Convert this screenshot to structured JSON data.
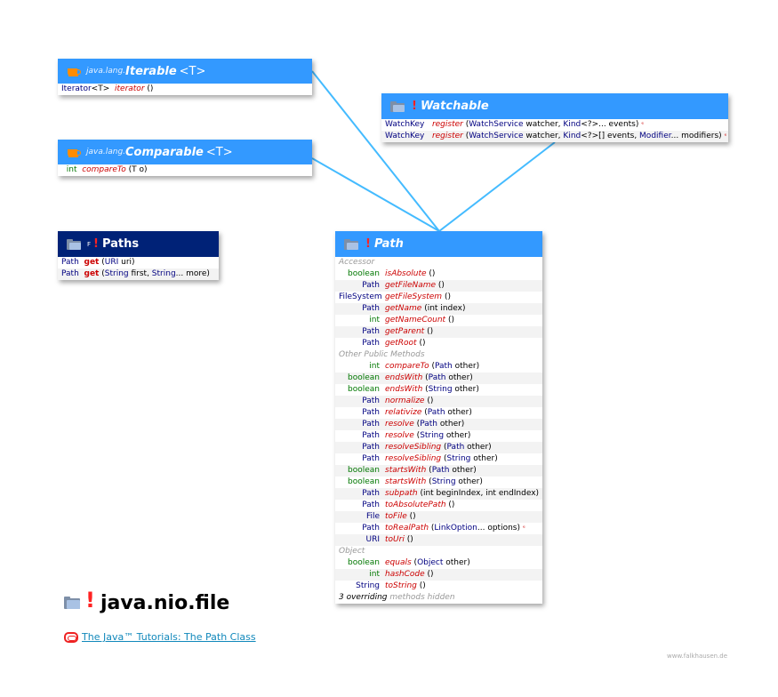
{
  "iterable": {
    "pkg": "java.lang.",
    "name": "Iterable",
    "type_param": "<T>",
    "methods": [
      {
        "ret": "Iterator",
        "ret_gen": "<T>",
        "name": "iterator",
        "params": "()"
      }
    ]
  },
  "comparable": {
    "pkg": "java.lang.",
    "name": "Comparable",
    "type_param": "<T>",
    "methods": [
      {
        "ret": "int",
        "name": "compareTo",
        "params": "(T o)"
      }
    ]
  },
  "watchable": {
    "excl": "!",
    "name": "Watchable",
    "methods": [
      {
        "ret": "WatchKey",
        "name": "register",
        "p1": "(",
        "p2": "WatchService",
        "p3": " watcher, ",
        "p4": "Kind",
        "p5": "<?>... events)",
        "ex": "ᵉ"
      },
      {
        "ret": "WatchKey",
        "name": "register",
        "p1": "(",
        "p2": "WatchService",
        "p3": " watcher, ",
        "p4": "Kind",
        "p5": "<?>[] events, ",
        "p6": "Modifier",
        "p7": "... modifiers)",
        "ex": "ᵉ"
      }
    ]
  },
  "paths": {
    "sup": "F",
    "excl": "!",
    "name": "Paths",
    "methods": [
      {
        "ret": "Path",
        "name": "get",
        "p1": "(",
        "p2": "URI",
        "p3": " uri)"
      },
      {
        "ret": "Path",
        "name": "get",
        "p1": "(",
        "p2": "String",
        "p3": " first, ",
        "p4": "String",
        "p5": "... more)"
      }
    ]
  },
  "path": {
    "excl": "!",
    "name": "Path",
    "sec_accessor": "Accessor",
    "sec_other": "Other Public Methods",
    "sec_object": "Object",
    "accessor": [
      {
        "ret": "boolean",
        "prim": true,
        "name": "isAbsolute",
        "params": "()"
      },
      {
        "ret": "Path",
        "name": "getFileName",
        "params": "()"
      },
      {
        "ret": "FileSystem",
        "name": "getFileSystem",
        "params": "()"
      },
      {
        "ret": "Path",
        "name": "getName",
        "params": "(int index)"
      },
      {
        "ret": "int",
        "prim": true,
        "name": "getNameCount",
        "params": "()"
      },
      {
        "ret": "Path",
        "name": "getParent",
        "params": "()"
      },
      {
        "ret": "Path",
        "name": "getRoot",
        "params": "()"
      }
    ],
    "other": [
      {
        "ret": "int",
        "prim": true,
        "name": "compareTo",
        "pt": "Path",
        "pr": " other)"
      },
      {
        "ret": "boolean",
        "prim": true,
        "name": "endsWith",
        "pt": "Path",
        "pr": " other)"
      },
      {
        "ret": "boolean",
        "prim": true,
        "name": "endsWith",
        "pt": "String",
        "pr": " other)"
      },
      {
        "ret": "Path",
        "name": "normalize",
        "params": "()"
      },
      {
        "ret": "Path",
        "name": "relativize",
        "pt": "Path",
        "pr": " other)"
      },
      {
        "ret": "Path",
        "name": "resolve",
        "pt": "Path",
        "pr": " other)"
      },
      {
        "ret": "Path",
        "name": "resolve",
        "pt": "String",
        "pr": " other)"
      },
      {
        "ret": "Path",
        "name": "resolveSibling",
        "pt": "Path",
        "pr": " other)"
      },
      {
        "ret": "Path",
        "name": "resolveSibling",
        "pt": "String",
        "pr": " other)"
      },
      {
        "ret": "boolean",
        "prim": true,
        "name": "startsWith",
        "pt": "Path",
        "pr": " other)"
      },
      {
        "ret": "boolean",
        "prim": true,
        "name": "startsWith",
        "pt": "String",
        "pr": " other)"
      },
      {
        "ret": "Path",
        "name": "subpath",
        "params": "(int beginIndex, int endIndex)"
      },
      {
        "ret": "Path",
        "name": "toAbsolutePath",
        "params": "()"
      },
      {
        "ret": "File",
        "name": "toFile",
        "params": "()"
      },
      {
        "ret": "Path",
        "name": "toRealPath",
        "pt": "LinkOption",
        "pr": "... options)",
        "ex": "ᵉ"
      },
      {
        "ret": "URI",
        "name": "toUri",
        "params": "()"
      }
    ],
    "object": [
      {
        "ret": "boolean",
        "prim": true,
        "name": "equals",
        "pt": "Object",
        "pr": " other)"
      },
      {
        "ret": "int",
        "prim": true,
        "name": "hashCode",
        "params": "()"
      },
      {
        "ret": "String",
        "name": "toString",
        "params": "()"
      }
    ],
    "footer_a": "3 overriding",
    "footer_b": " methods hidden"
  },
  "package_title": "java.nio.file",
  "package_excl": "!",
  "tutorial_link": "The Java™ Tutorials: The Path Class",
  "credit": "www.falkhausen.de",
  "colors": {
    "header_blue": "#3399ff",
    "header_dark": "#002277",
    "connector": "#44bbff"
  }
}
